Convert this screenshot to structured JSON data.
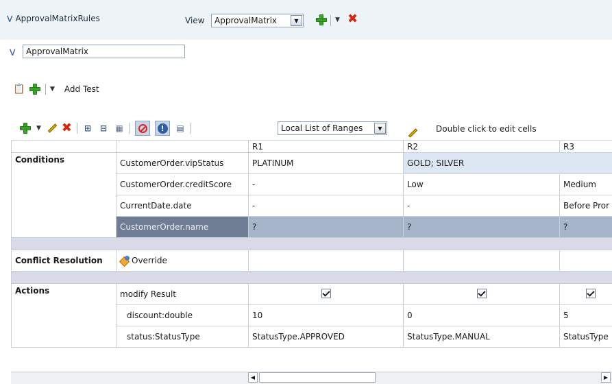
{
  "header": {
    "ruleset_name": "ApprovalMatrixRules",
    "view_label": "View",
    "view_value": "ApprovalMatrix"
  },
  "decision_table": {
    "name": "ApprovalMatrix",
    "add_test_label": "Add Test",
    "ranges_select": "Local List of Ranges",
    "edit_hint": "Double click to edit cells"
  },
  "grid": {
    "columns": [
      "R1",
      "R2",
      "R3"
    ],
    "conditions_label": "Conditions",
    "conditions": [
      {
        "name": "CustomerOrder.vipStatus",
        "values": [
          "PLATINUM",
          "GOLD; SILVER",
          ""
        ]
      },
      {
        "name": "CustomerOrder.creditScore",
        "values": [
          "-",
          "Low",
          "Medium"
        ]
      },
      {
        "name": "CurrentDate.date",
        "values": [
          "-",
          "-",
          "Before Pror"
        ]
      },
      {
        "name": "CustomerOrder.name",
        "values": [
          "?",
          "?",
          "?"
        ]
      }
    ],
    "conflict_label": "Conflict Resolution",
    "conflict_value": "Override",
    "actions_label": "Actions",
    "actions": [
      {
        "name": "modify Result",
        "checked": [
          true,
          true,
          true
        ]
      },
      {
        "name": "discount:double",
        "values": [
          "10",
          "0",
          "5"
        ]
      },
      {
        "name": "status:StatusType",
        "values": [
          "StatusType.APPROVED",
          "StatusType.MANUAL",
          "StatusType"
        ]
      }
    ]
  },
  "colors": {
    "selected_row": "#a6b5ca",
    "highlight_cell": "#dde7f3",
    "band": "#d9dae8"
  }
}
